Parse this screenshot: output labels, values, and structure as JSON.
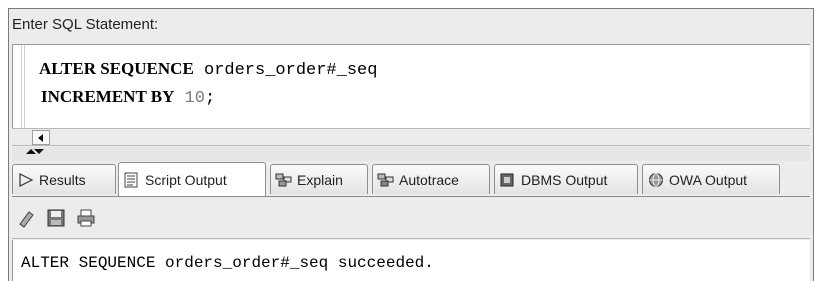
{
  "sql_label": "Enter SQL Statement:",
  "editor": {
    "line1_kw": "ALTER SEQUENCE",
    "line1_rest": " orders_order#_seq",
    "line2_kw": "INCREMENT BY",
    "line2_num": "10",
    "line2_tail": ";"
  },
  "tabs": [
    {
      "label": "Results",
      "icon": "play-triangle-icon"
    },
    {
      "label": "Script Output",
      "icon": "script-output-icon"
    },
    {
      "label": "Explain",
      "icon": "explain-plan-icon"
    },
    {
      "label": "Autotrace",
      "icon": "autotrace-icon"
    },
    {
      "label": "DBMS Output",
      "icon": "dbms-output-icon"
    },
    {
      "label": "OWA Output",
      "icon": "owa-output-icon"
    }
  ],
  "active_tab": "Script Output",
  "toolbar": {
    "icons": [
      "eraser-icon",
      "save-icon",
      "print-icon"
    ]
  },
  "output_text": "ALTER SEQUENCE orders_order#_seq succeeded."
}
